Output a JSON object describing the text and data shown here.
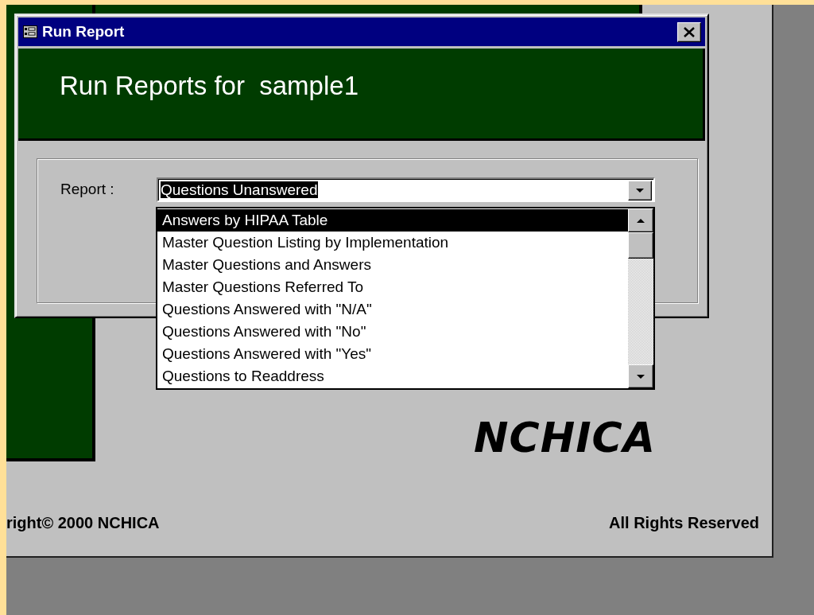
{
  "dialog": {
    "title": "Run Report",
    "banner": "Run Reports for  sample1",
    "report_label": "Report :",
    "combo": {
      "value": "Questions Unanswered",
      "text_selected": true
    },
    "dropdown": {
      "expanded": true,
      "items": [
        {
          "label": "Answers by HIPAA Table",
          "selected": true
        },
        {
          "label": "Master Question Listing by Implementation",
          "selected": false
        },
        {
          "label": "Master Questions and Answers",
          "selected": false
        },
        {
          "label": "Master Questions Referred To",
          "selected": false
        },
        {
          "label": "Questions Answered with \"N/A\"",
          "selected": false
        },
        {
          "label": "Questions Answered with \"No\"",
          "selected": false
        },
        {
          "label": "Questions Answered with \"Yes\"",
          "selected": false
        },
        {
          "label": "Questions to Readdress",
          "selected": false
        }
      ]
    }
  },
  "background_form": {
    "logo": "NCHICA",
    "footer_left": "right© 2000 NCHICA",
    "footer_right": "All Rights Reserved"
  }
}
